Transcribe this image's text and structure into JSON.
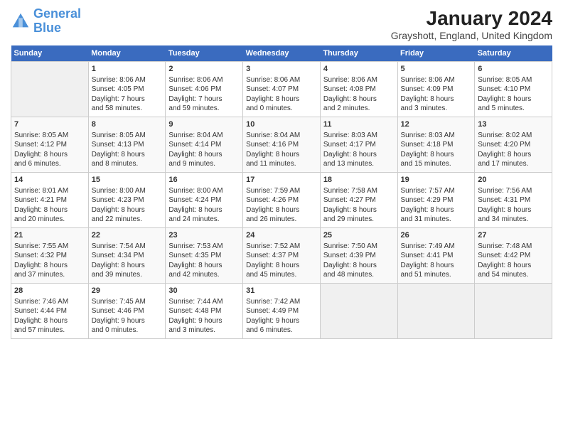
{
  "header": {
    "logo_line1": "General",
    "logo_line2": "Blue",
    "title": "January 2024",
    "subtitle": "Grayshott, England, United Kingdom"
  },
  "days_of_week": [
    "Sunday",
    "Monday",
    "Tuesday",
    "Wednesday",
    "Thursday",
    "Friday",
    "Saturday"
  ],
  "weeks": [
    [
      {
        "num": "",
        "info": ""
      },
      {
        "num": "1",
        "info": "Sunrise: 8:06 AM\nSunset: 4:05 PM\nDaylight: 7 hours\nand 58 minutes."
      },
      {
        "num": "2",
        "info": "Sunrise: 8:06 AM\nSunset: 4:06 PM\nDaylight: 7 hours\nand 59 minutes."
      },
      {
        "num": "3",
        "info": "Sunrise: 8:06 AM\nSunset: 4:07 PM\nDaylight: 8 hours\nand 0 minutes."
      },
      {
        "num": "4",
        "info": "Sunrise: 8:06 AM\nSunset: 4:08 PM\nDaylight: 8 hours\nand 2 minutes."
      },
      {
        "num": "5",
        "info": "Sunrise: 8:06 AM\nSunset: 4:09 PM\nDaylight: 8 hours\nand 3 minutes."
      },
      {
        "num": "6",
        "info": "Sunrise: 8:05 AM\nSunset: 4:10 PM\nDaylight: 8 hours\nand 5 minutes."
      }
    ],
    [
      {
        "num": "7",
        "info": "Sunrise: 8:05 AM\nSunset: 4:12 PM\nDaylight: 8 hours\nand 6 minutes."
      },
      {
        "num": "8",
        "info": "Sunrise: 8:05 AM\nSunset: 4:13 PM\nDaylight: 8 hours\nand 8 minutes."
      },
      {
        "num": "9",
        "info": "Sunrise: 8:04 AM\nSunset: 4:14 PM\nDaylight: 8 hours\nand 9 minutes."
      },
      {
        "num": "10",
        "info": "Sunrise: 8:04 AM\nSunset: 4:16 PM\nDaylight: 8 hours\nand 11 minutes."
      },
      {
        "num": "11",
        "info": "Sunrise: 8:03 AM\nSunset: 4:17 PM\nDaylight: 8 hours\nand 13 minutes."
      },
      {
        "num": "12",
        "info": "Sunrise: 8:03 AM\nSunset: 4:18 PM\nDaylight: 8 hours\nand 15 minutes."
      },
      {
        "num": "13",
        "info": "Sunrise: 8:02 AM\nSunset: 4:20 PM\nDaylight: 8 hours\nand 17 minutes."
      }
    ],
    [
      {
        "num": "14",
        "info": "Sunrise: 8:01 AM\nSunset: 4:21 PM\nDaylight: 8 hours\nand 20 minutes."
      },
      {
        "num": "15",
        "info": "Sunrise: 8:00 AM\nSunset: 4:23 PM\nDaylight: 8 hours\nand 22 minutes."
      },
      {
        "num": "16",
        "info": "Sunrise: 8:00 AM\nSunset: 4:24 PM\nDaylight: 8 hours\nand 24 minutes."
      },
      {
        "num": "17",
        "info": "Sunrise: 7:59 AM\nSunset: 4:26 PM\nDaylight: 8 hours\nand 26 minutes."
      },
      {
        "num": "18",
        "info": "Sunrise: 7:58 AM\nSunset: 4:27 PM\nDaylight: 8 hours\nand 29 minutes."
      },
      {
        "num": "19",
        "info": "Sunrise: 7:57 AM\nSunset: 4:29 PM\nDaylight: 8 hours\nand 31 minutes."
      },
      {
        "num": "20",
        "info": "Sunrise: 7:56 AM\nSunset: 4:31 PM\nDaylight: 8 hours\nand 34 minutes."
      }
    ],
    [
      {
        "num": "21",
        "info": "Sunrise: 7:55 AM\nSunset: 4:32 PM\nDaylight: 8 hours\nand 37 minutes."
      },
      {
        "num": "22",
        "info": "Sunrise: 7:54 AM\nSunset: 4:34 PM\nDaylight: 8 hours\nand 39 minutes."
      },
      {
        "num": "23",
        "info": "Sunrise: 7:53 AM\nSunset: 4:35 PM\nDaylight: 8 hours\nand 42 minutes."
      },
      {
        "num": "24",
        "info": "Sunrise: 7:52 AM\nSunset: 4:37 PM\nDaylight: 8 hours\nand 45 minutes."
      },
      {
        "num": "25",
        "info": "Sunrise: 7:50 AM\nSunset: 4:39 PM\nDaylight: 8 hours\nand 48 minutes."
      },
      {
        "num": "26",
        "info": "Sunrise: 7:49 AM\nSunset: 4:41 PM\nDaylight: 8 hours\nand 51 minutes."
      },
      {
        "num": "27",
        "info": "Sunrise: 7:48 AM\nSunset: 4:42 PM\nDaylight: 8 hours\nand 54 minutes."
      }
    ],
    [
      {
        "num": "28",
        "info": "Sunrise: 7:46 AM\nSunset: 4:44 PM\nDaylight: 8 hours\nand 57 minutes."
      },
      {
        "num": "29",
        "info": "Sunrise: 7:45 AM\nSunset: 4:46 PM\nDaylight: 9 hours\nand 0 minutes."
      },
      {
        "num": "30",
        "info": "Sunrise: 7:44 AM\nSunset: 4:48 PM\nDaylight: 9 hours\nand 3 minutes."
      },
      {
        "num": "31",
        "info": "Sunrise: 7:42 AM\nSunset: 4:49 PM\nDaylight: 9 hours\nand 6 minutes."
      },
      {
        "num": "",
        "info": ""
      },
      {
        "num": "",
        "info": ""
      },
      {
        "num": "",
        "info": ""
      }
    ]
  ]
}
